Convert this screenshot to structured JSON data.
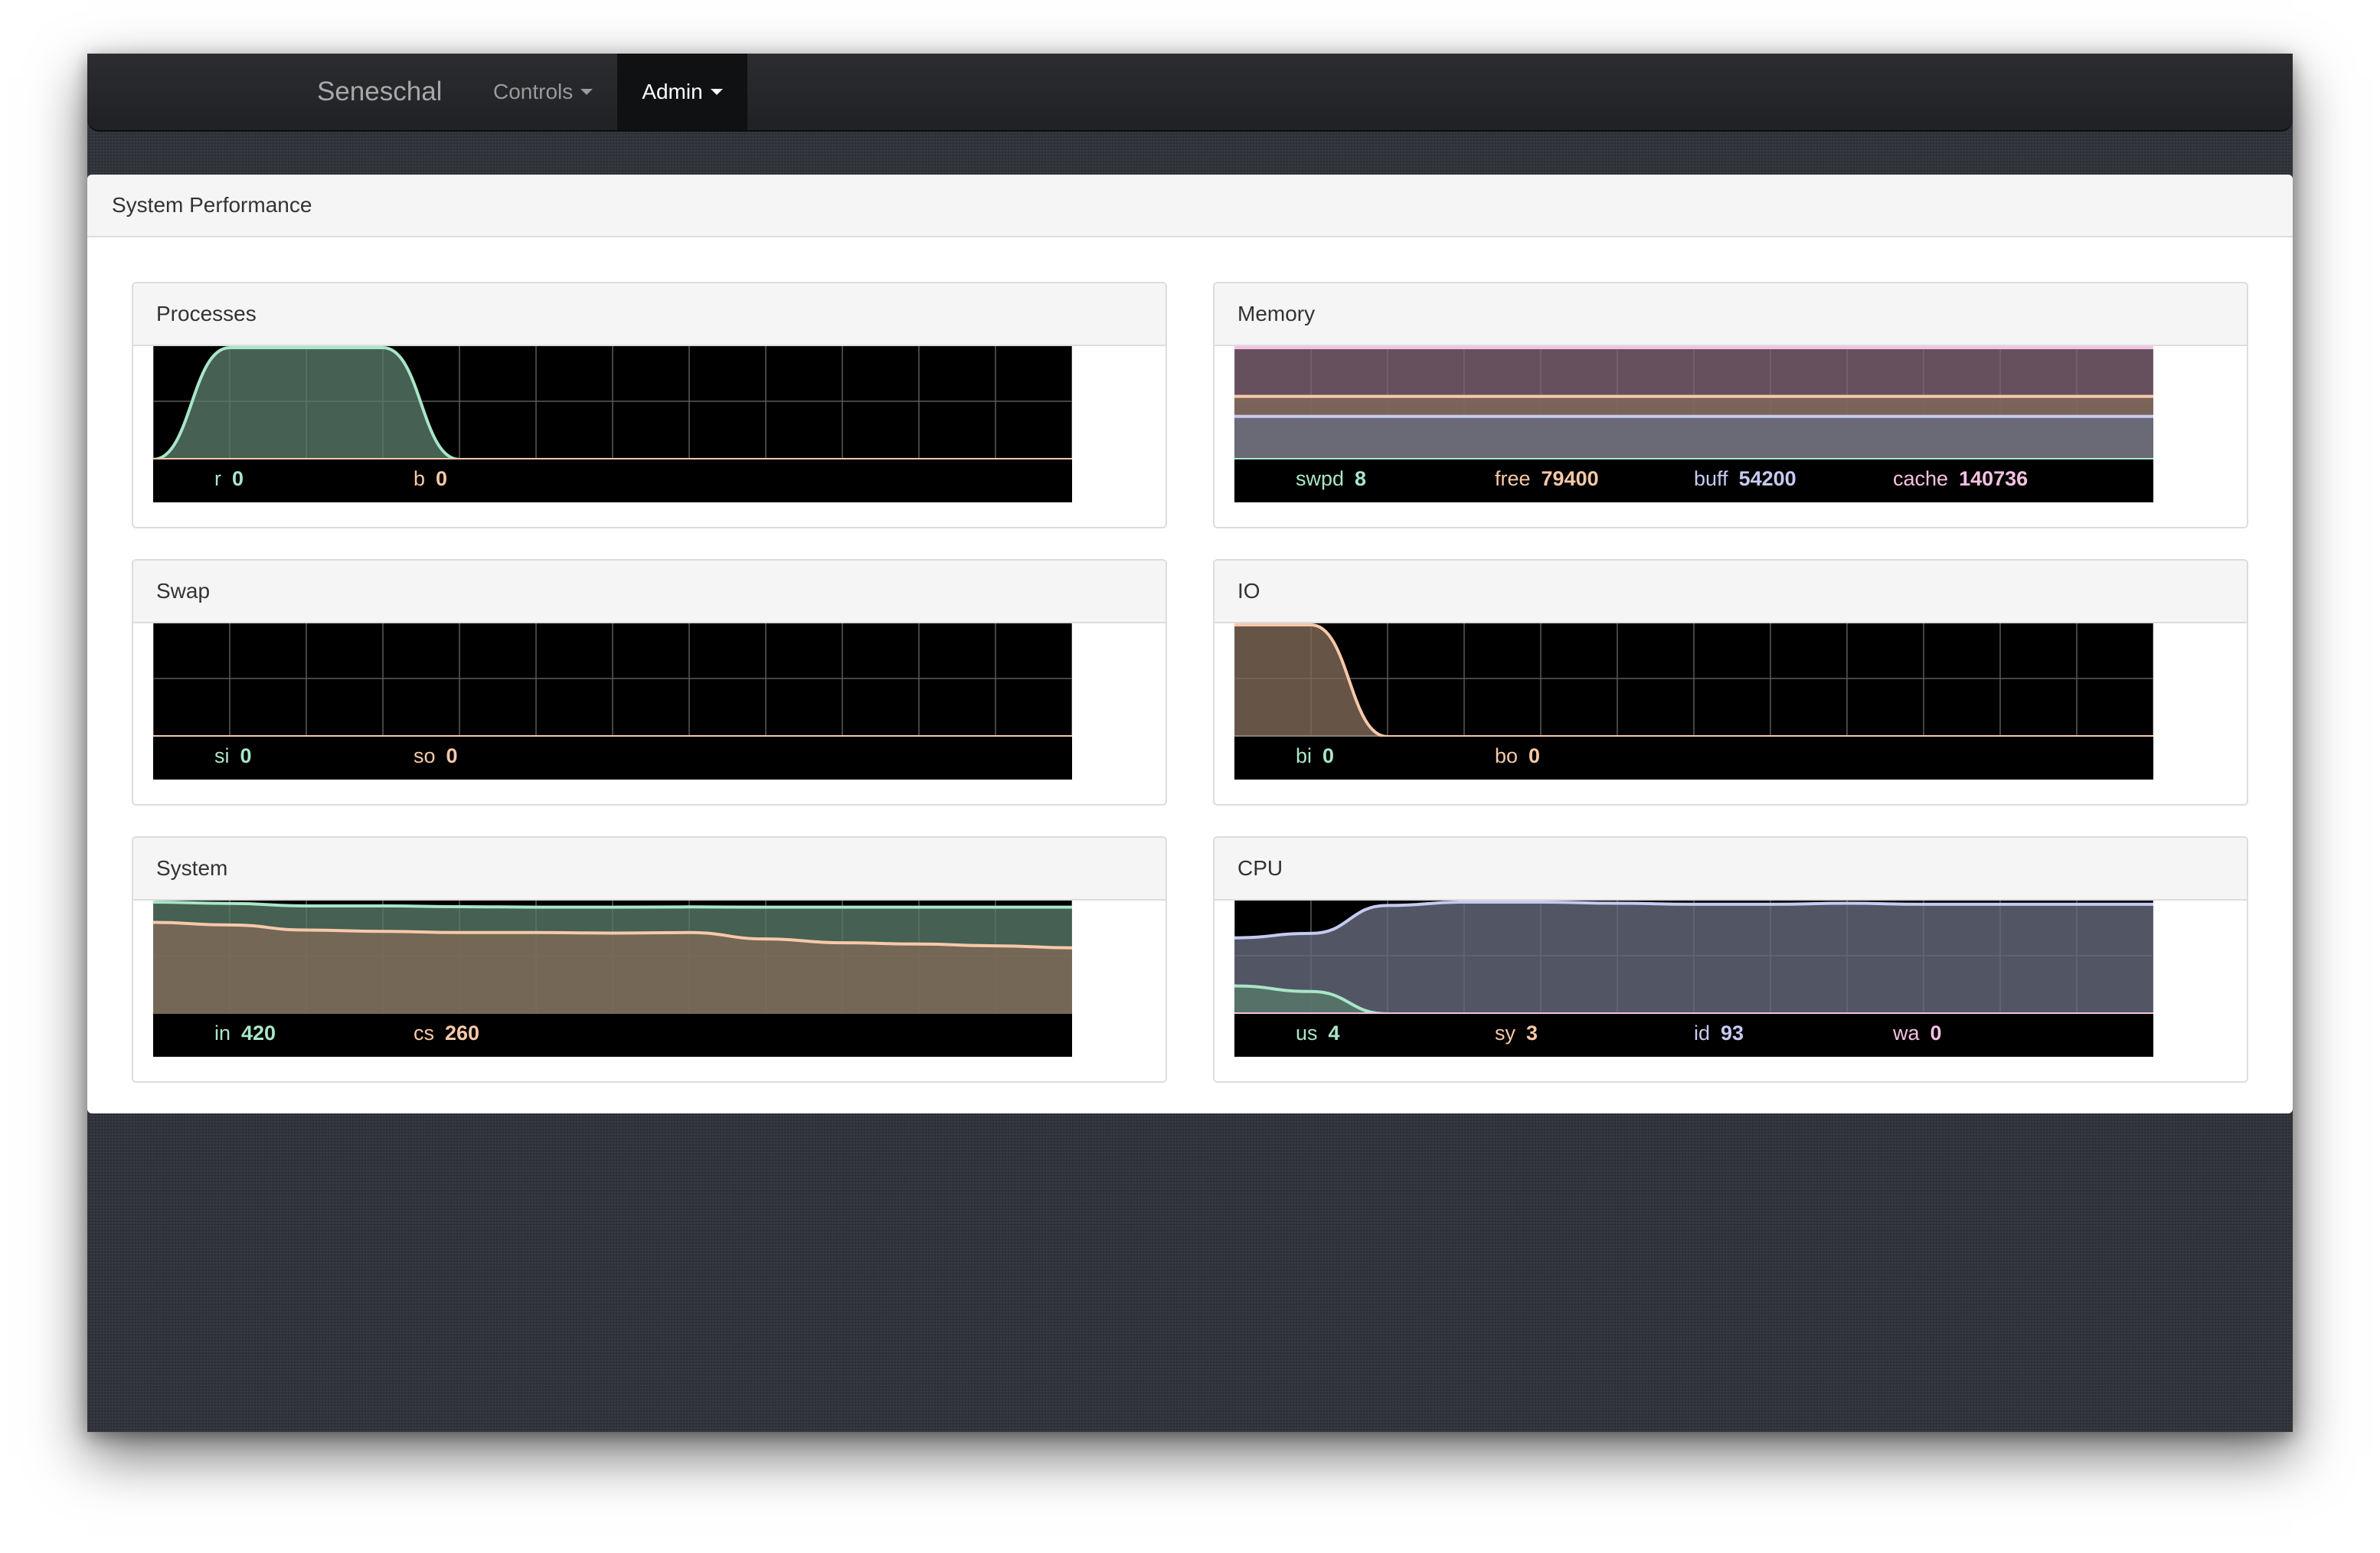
{
  "navbar": {
    "brand": "Seneschal",
    "controls_label": "Controls",
    "admin_label": "Admin"
  },
  "panel": {
    "title": "System Performance"
  },
  "colors": {
    "green": "#a8e6c8",
    "peach": "#f7c9a8",
    "lavender": "#c5cbf0",
    "pink": "#f5c0e2",
    "grid": "#5a5a5a",
    "chart_bg": "#000000"
  },
  "cards": [
    {
      "title": "Processes",
      "series": [
        {
          "name": "r",
          "value": "0"
        },
        {
          "name": "b",
          "value": "0"
        }
      ]
    },
    {
      "title": "Memory",
      "series": [
        {
          "name": "swpd",
          "value": "8"
        },
        {
          "name": "free",
          "value": "79400"
        },
        {
          "name": "buff",
          "value": "54200"
        },
        {
          "name": "cache",
          "value": "140736"
        }
      ]
    },
    {
      "title": "Swap",
      "series": [
        {
          "name": "si",
          "value": "0"
        },
        {
          "name": "so",
          "value": "0"
        }
      ]
    },
    {
      "title": "IO",
      "series": [
        {
          "name": "bi",
          "value": "0"
        },
        {
          "name": "bo",
          "value": "0"
        }
      ]
    },
    {
      "title": "System",
      "series": [
        {
          "name": "in",
          "value": "420"
        },
        {
          "name": "cs",
          "value": "260"
        }
      ]
    },
    {
      "title": "CPU",
      "series": [
        {
          "name": "us",
          "value": "4"
        },
        {
          "name": "sy",
          "value": "3"
        },
        {
          "name": "id",
          "value": "93"
        },
        {
          "name": "wa",
          "value": "0"
        }
      ]
    }
  ],
  "chart_data": [
    {
      "type": "area",
      "title": "Processes",
      "x": [
        0,
        1,
        2,
        3,
        4,
        5,
        6,
        7,
        8,
        9,
        10,
        11,
        12
      ],
      "series": [
        {
          "name": "r",
          "values": [
            0,
            1,
            1,
            1,
            0,
            0,
            0,
            0,
            0,
            0,
            0,
            0,
            0
          ]
        },
        {
          "name": "b",
          "values": [
            0,
            0,
            0,
            0,
            0,
            0,
            0,
            0,
            0,
            0,
            0,
            0,
            0
          ]
        }
      ],
      "ylim": [
        0,
        1
      ]
    },
    {
      "type": "area",
      "title": "Memory",
      "x": [
        0,
        1,
        2,
        3,
        4,
        5,
        6,
        7,
        8,
        9,
        10,
        11,
        12
      ],
      "series": [
        {
          "name": "cache",
          "values": [
            140736,
            140736,
            140736,
            140736,
            140736,
            140736,
            140736,
            140736,
            140736,
            140736,
            140736,
            140736,
            140736
          ]
        },
        {
          "name": "free",
          "values": [
            79400,
            79400,
            79400,
            79400,
            79400,
            79400,
            79400,
            79400,
            79400,
            79400,
            79400,
            79400,
            79400
          ]
        },
        {
          "name": "buff",
          "values": [
            54200,
            54200,
            54200,
            54200,
            54200,
            54200,
            54200,
            54200,
            54200,
            54200,
            54200,
            54200,
            54200
          ]
        },
        {
          "name": "swpd",
          "values": [
            8,
            8,
            8,
            8,
            8,
            8,
            8,
            8,
            8,
            8,
            8,
            8,
            8
          ]
        }
      ],
      "ylim": [
        0,
        140736
      ]
    },
    {
      "type": "area",
      "title": "Swap",
      "x": [
        0,
        1,
        2,
        3,
        4,
        5,
        6,
        7,
        8,
        9,
        10,
        11,
        12
      ],
      "series": [
        {
          "name": "si",
          "values": [
            0,
            0,
            0,
            0,
            0,
            0,
            0,
            0,
            0,
            0,
            0,
            0,
            0
          ]
        },
        {
          "name": "so",
          "values": [
            0,
            0,
            0,
            0,
            0,
            0,
            0,
            0,
            0,
            0,
            0,
            0,
            0
          ]
        }
      ],
      "ylim": [
        0,
        1
      ]
    },
    {
      "type": "area",
      "title": "IO",
      "x": [
        0,
        1,
        2,
        3,
        4,
        5,
        6,
        7,
        8,
        9,
        10,
        11,
        12
      ],
      "series": [
        {
          "name": "bi",
          "values": [
            0,
            0,
            0,
            0,
            0,
            0,
            0,
            0,
            0,
            0,
            0,
            0,
            0
          ]
        },
        {
          "name": "bo",
          "values": [
            1,
            1,
            0,
            0,
            0,
            0,
            0,
            0,
            0,
            0,
            0,
            0,
            0
          ]
        }
      ],
      "ylim": [
        0,
        1
      ]
    },
    {
      "type": "area",
      "title": "System",
      "x": [
        0,
        1,
        2,
        3,
        4,
        5,
        6,
        7,
        8,
        9,
        10,
        11,
        12
      ],
      "series": [
        {
          "name": "in",
          "values": [
            440,
            435,
            425,
            425,
            422,
            420,
            420,
            421,
            420,
            420,
            420,
            420,
            420
          ]
        },
        {
          "name": "cs",
          "values": [
            360,
            350,
            330,
            325,
            320,
            320,
            318,
            320,
            295,
            280,
            275,
            268,
            260
          ]
        }
      ],
      "ylim": [
        0,
        440
      ]
    },
    {
      "type": "area",
      "title": "CPU",
      "x": [
        0,
        1,
        2,
        3,
        4,
        5,
        6,
        7,
        8,
        9,
        10,
        11,
        12
      ],
      "series": [
        {
          "name": "id",
          "values": [
            68,
            72,
            97,
            100,
            100,
            99,
            98,
            98,
            99,
            98,
            98,
            98,
            98
          ]
        },
        {
          "name": "us",
          "values": [
            25,
            20,
            0,
            0,
            0,
            0,
            0,
            0,
            0,
            0,
            0,
            0,
            0
          ]
        },
        {
          "name": "sy",
          "values": [
            0,
            0,
            0,
            0,
            0,
            0,
            0,
            0,
            0,
            0,
            0,
            0,
            0
          ]
        },
        {
          "name": "wa",
          "values": [
            0,
            0,
            0,
            0,
            0,
            0,
            0,
            0,
            0,
            0,
            0,
            0,
            0
          ]
        }
      ],
      "ylim": [
        0,
        100
      ]
    }
  ]
}
